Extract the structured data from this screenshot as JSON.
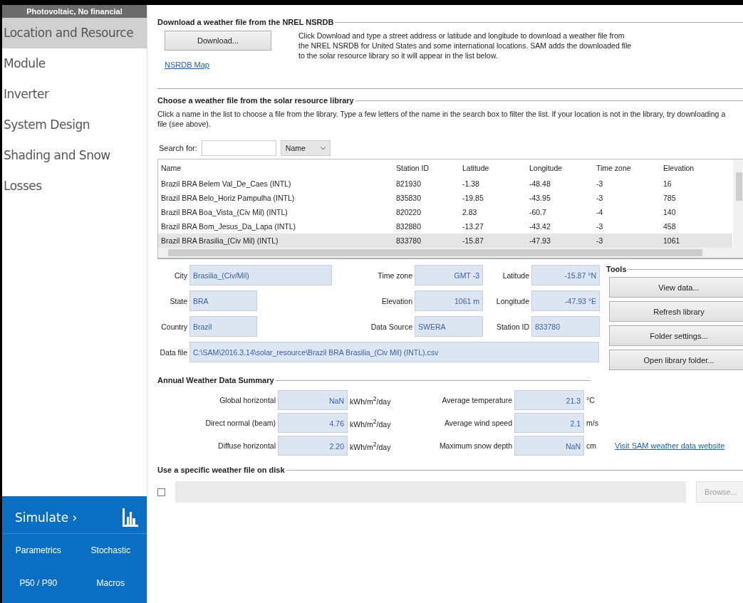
{
  "sidebar": {
    "header": "Photovoltaic, No financial",
    "items": [
      {
        "label": "Location and Resource",
        "selected": true
      },
      {
        "label": "Module",
        "selected": false
      },
      {
        "label": "Inverter",
        "selected": false
      },
      {
        "label": "System Design",
        "selected": false
      },
      {
        "label": "Shading and Snow",
        "selected": false
      },
      {
        "label": "Losses",
        "selected": false
      }
    ],
    "simulate": "Simulate ›",
    "tools": [
      "Parametrics",
      "Stochastic",
      "P50 / P90",
      "Macros"
    ]
  },
  "download": {
    "title": "Download a weather file from the NREL NSRDB",
    "button": "Download...",
    "description": "Click Download and type a street address or latitude and longitude to download a weather file from the NREL NSRDB for United States and some international locations. SAM adds the downloaded file to the solar resource library so it will appear in the list below.",
    "link": "NSRDB Map"
  },
  "library": {
    "title": "Choose a weather file from the solar resource library",
    "instructions": "Click a name in the list to choose a file from the library. Type a few letters of the name in the search box to filter the list.  If your location is not in the library, try downloading a file (see above).",
    "search_label": "Search for:",
    "filter_dropdown": "Name",
    "table": {
      "columns": [
        "Name",
        "Station ID",
        "Latitude",
        "Longitude",
        "Time zone",
        "Elevation"
      ],
      "rows": [
        {
          "cells": [
            "Brazil BRA Belem Val_De_Caes (INTL)",
            "821930",
            "-1.38",
            "-48.48",
            "-3",
            "16"
          ],
          "selected": false
        },
        {
          "cells": [
            "Brazil BRA Belo_Horiz Pampulha (INTL)",
            "835830",
            "-19.85",
            "-43.95",
            "-3",
            "785"
          ],
          "selected": false
        },
        {
          "cells": [
            "Brazil BRA Boa_Vista_(Civ Mil) (INTL)",
            "820220",
            "2.83",
            "-60.7",
            "-4",
            "140"
          ],
          "selected": false
        },
        {
          "cells": [
            "Brazil BRA Bom_Jesus_Da_Lapa (INTL)",
            "832880",
            "-13.27",
            "-43.42",
            "-3",
            "458"
          ],
          "selected": false
        },
        {
          "cells": [
            "Brazil BRA Brasilia_(Civ Mil) (INTL)",
            "833780",
            "-15.87",
            "-47.93",
            "-3",
            "1061"
          ],
          "selected": true
        }
      ]
    }
  },
  "location": {
    "rows": [
      [
        {
          "label": "City",
          "value": "Brasilia_(Civ/Mil)",
          "kind": "wide"
        },
        {
          "label": "Time zone",
          "value": "GMT -3",
          "kind": "number"
        },
        {
          "label": "Latitude",
          "value": "-15.87 °N",
          "kind": "number"
        }
      ],
      [
        {
          "label": "State",
          "value": "BRA",
          "kind": "short"
        },
        {
          "label": "Elevation",
          "value": "1061 m",
          "kind": "number"
        },
        {
          "label": "Longitude",
          "value": "-47.93 °E",
          "kind": "number"
        }
      ],
      [
        {
          "label": "Country",
          "value": "Brazil",
          "kind": "short"
        },
        {
          "label": "Data Source",
          "value": "SWERA",
          "kind": "text"
        },
        {
          "label": "Station ID",
          "value": "833780",
          "kind": "text"
        }
      ]
    ],
    "data_file": {
      "label": "Data file",
      "value": "C:\\SAM\\2016.3.14\\solar_resource\\Brazil BRA Brasilia_(Civ Mil) (INTL).csv"
    }
  },
  "tools": {
    "title": "Tools",
    "buttons": [
      "View data...",
      "Refresh library",
      "Folder settings...",
      "Open library folder..."
    ]
  },
  "summary": {
    "title": "Annual Weather Data Summary",
    "rows": [
      {
        "label": "Global horizontal",
        "value": "NaN",
        "unit": "kWh/m$^{2}$/day",
        "label_2": "Average temperature",
        "value_2": "21.3",
        "unit_2": "°C"
      },
      {
        "label": "Direct normal (beam)",
        "value": "4.76",
        "unit": "kWh/m$^{2}$/day",
        "label_2": "Average wind speed",
        "value_2": "2.1",
        "unit_2": "m/s"
      },
      {
        "label": "Diffuse horizontal",
        "value": "2.20",
        "unit": "kWh/m$^{2}$/day",
        "label_2": "Maximum snow depth",
        "value_2": "NaN",
        "unit_2": "cm"
      }
    ],
    "link": "Visit SAM weather data website"
  },
  "disk": {
    "title": "Use a specific weather file on disk",
    "checked": false,
    "button": "Browse...",
    "button_disabled": true
  }
}
